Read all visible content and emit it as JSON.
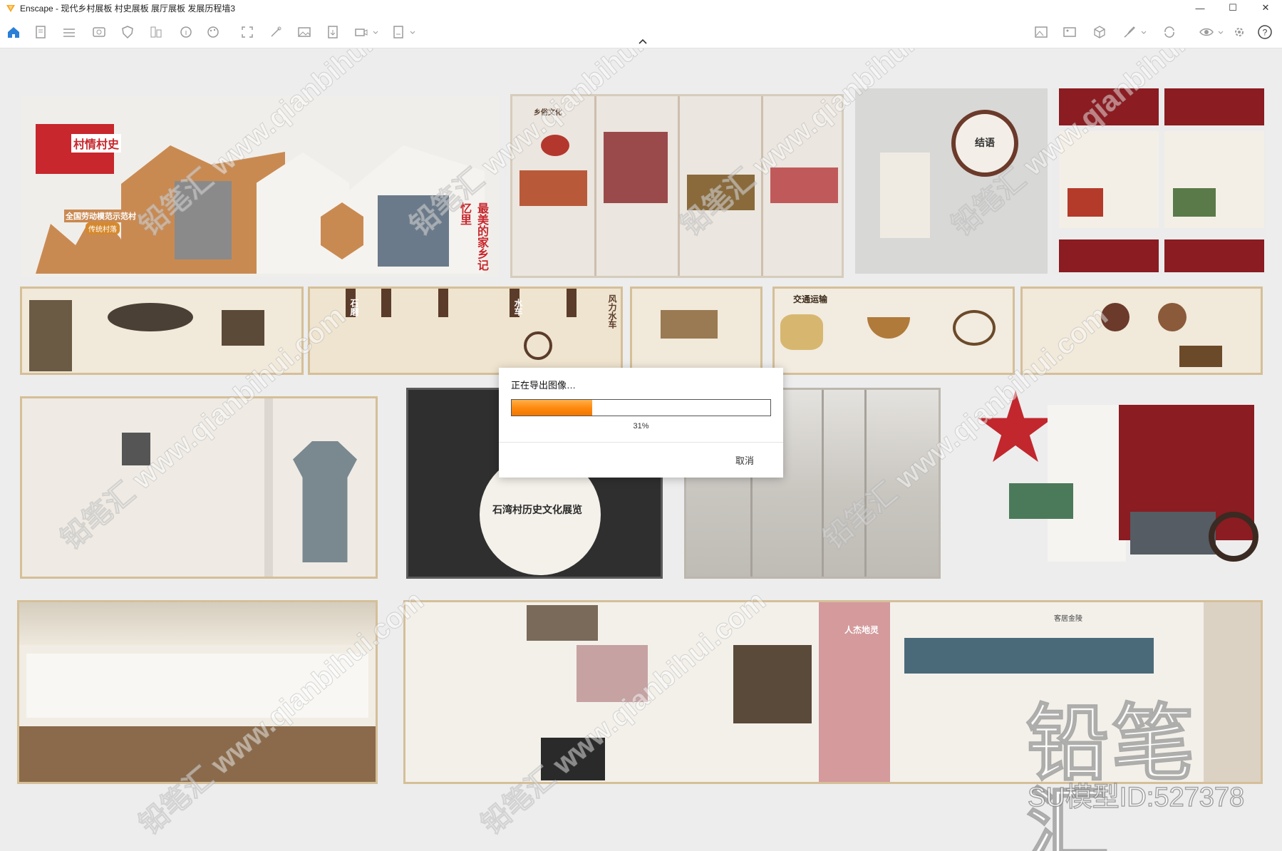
{
  "window": {
    "title": "Enscape - 现代乡村展板 村史展板 展厅展板 发展历程墙3",
    "minimize": "—",
    "maximize": "☐",
    "close": "✕"
  },
  "toolbar": {
    "help": "?",
    "icons": [
      "home-icon",
      "new-icon",
      "settings-icon",
      "capture-icon",
      "shield-icon",
      "asset-icon",
      "info-icon",
      "palette-icon",
      "screenshot-icon",
      "render-icon",
      "image-icon",
      "export-icon",
      "video-icon",
      "panorama-icon",
      "landscape-icon",
      "views-icon",
      "cube-icon",
      "brush-icon",
      "sync-icon",
      "visibility-icon",
      "gear-icon",
      "help-icon"
    ]
  },
  "dialog": {
    "title": "正在导出图像…",
    "progress": 31,
    "progress_label": "31%",
    "cancel": "取消"
  },
  "scene": {
    "panels": {
      "rural_history": {
        "title": "村情村史",
        "subtitle": "全国劳动模范示范村",
        "tag": "传统村落",
        "slogan": "最美的家乡记忆里"
      },
      "folk_culture": {
        "label": "乡俗文化"
      },
      "conclusion": {
        "label": "结语"
      },
      "agri_tools": [
        "石磨",
        "水车",
        "风力水车"
      ],
      "transport": {
        "label": "交通运输"
      },
      "residence": {
        "label": "客居金陵"
      },
      "hero": {
        "label": "人杰地灵"
      },
      "mid_title": "石湾村历史文化展览"
    }
  },
  "watermark": {
    "brand": "铅笔汇",
    "model_id": "SU模型ID:527378",
    "tile": "铅笔汇 www.qianbihui.com"
  },
  "colors": {
    "accent": "#ff8a10",
    "panel_wood": "#c98a52",
    "panel_red": "#8a1c22",
    "pink_panel": "#d49a9c"
  }
}
